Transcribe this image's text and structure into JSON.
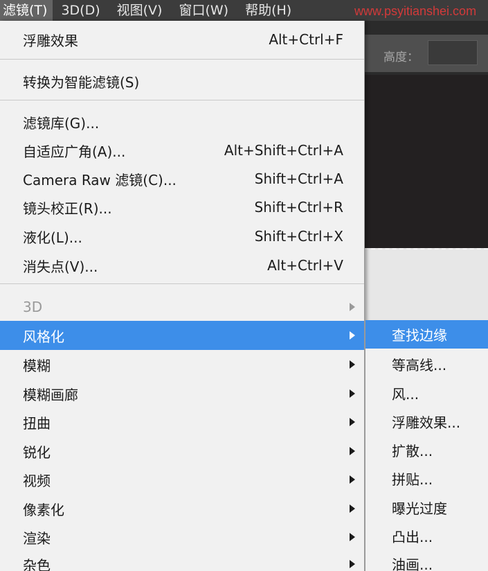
{
  "menubar": {
    "items": [
      "滤镜(T)",
      "3D(D)",
      "视图(V)",
      "窗口(W)",
      "帮助(H)"
    ],
    "active_index": 0
  },
  "watermark": "www.psyitianshei.com",
  "toolbar": {
    "height_label": "高度："
  },
  "menu": {
    "items": [
      {
        "label": "浮雕效果",
        "shortcut": "Alt+Ctrl+F"
      },
      {
        "label": "转换为智能滤镜(S)",
        "shortcut": ""
      },
      {
        "label": "滤镜库(G)...",
        "shortcut": ""
      },
      {
        "label": "自适应广角(A)...",
        "shortcut": "Alt+Shift+Ctrl+A"
      },
      {
        "label": "Camera Raw 滤镜(C)...",
        "shortcut": "Shift+Ctrl+A"
      },
      {
        "label": "镜头校正(R)...",
        "shortcut": "Shift+Ctrl+R"
      },
      {
        "label": "液化(L)...",
        "shortcut": "Shift+Ctrl+X"
      },
      {
        "label": "消失点(V)...",
        "shortcut": "Alt+Ctrl+V"
      },
      {
        "label": "3D",
        "shortcut": ""
      },
      {
        "label": "风格化",
        "shortcut": ""
      },
      {
        "label": "模糊",
        "shortcut": ""
      },
      {
        "label": "模糊画廊",
        "shortcut": ""
      },
      {
        "label": "扭曲",
        "shortcut": ""
      },
      {
        "label": "锐化",
        "shortcut": ""
      },
      {
        "label": "视频",
        "shortcut": ""
      },
      {
        "label": "像素化",
        "shortcut": ""
      },
      {
        "label": "渲染",
        "shortcut": ""
      },
      {
        "label": "杂色",
        "shortcut": ""
      }
    ]
  },
  "submenu": {
    "items": [
      "查找边缘",
      "等高线...",
      "风...",
      "浮雕效果...",
      "扩散...",
      "拼贴...",
      "曝光过度",
      "凸出...",
      "油画..."
    ]
  },
  "colors": {
    "highlight": "#3d8ee9",
    "menu_bg": "#f1f1f1",
    "menubar_bg": "#3c3c3c"
  }
}
